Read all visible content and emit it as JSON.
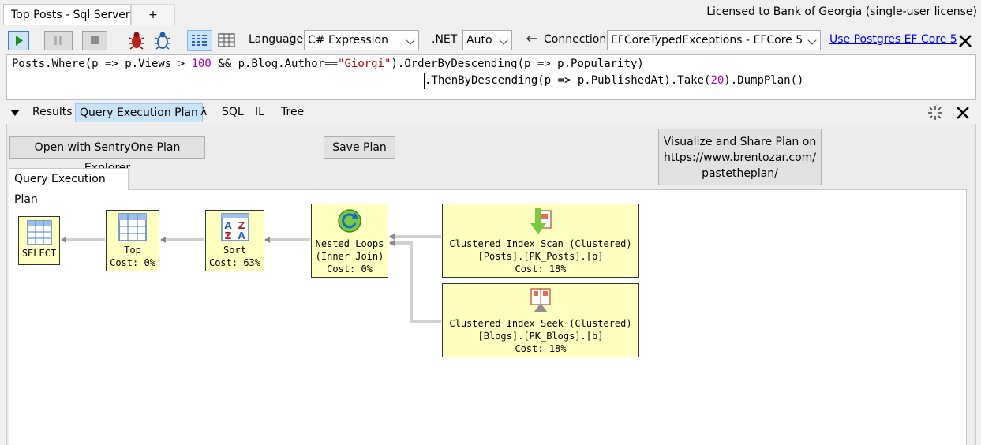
{
  "tabs": [
    {
      "label": "Top Posts - Sql Server"
    },
    {
      "label": "+"
    }
  ],
  "license": "Licensed to Bank of Georgia (single-user license)",
  "toolbar": {
    "language_label": "Language",
    "language_value": "C# Expression",
    "net_label": ".NET",
    "net_value": "Auto",
    "connection_label": "Connection",
    "connection_value": "EFCoreTypedExceptions - EFCore 5",
    "link": "Use Postgres EF Core 5"
  },
  "editor": {
    "line1": {
      "a": "Posts.Where(p => p.Views > ",
      "num1": "100",
      "b": " && p.Blog.Author==",
      "str1": "\"Giorgi\"",
      "c": ").OrderByDescending(p => p.Popularity)"
    },
    "line2": {
      "a": ".ThenByDescending(p => p.PublishedAt).Take(",
      "num1": "20",
      "b": ").DumpPlan()"
    }
  },
  "result_tabs": [
    "Results",
    "Query Execution Plan",
    "λ",
    "SQL",
    "IL",
    "Tree"
  ],
  "panel": {
    "open_button": "Open with SentryOne Plan Explorer",
    "save_button": "Save Plan",
    "visualize_button": {
      "line1": "Visualize and Share Plan on",
      "line2": "https://www.brentozar.com/",
      "line3": "pastetheplan/"
    },
    "plan_tab": "Query Execution Plan"
  },
  "plan_nodes": {
    "select": {
      "label": "SELECT"
    },
    "top": {
      "label": "Top",
      "cost": "Cost: 0%"
    },
    "sort": {
      "label": "Sort",
      "cost": "Cost: 63%"
    },
    "nested": {
      "label1": "Nested Loops",
      "label2": "(Inner Join)",
      "cost": "Cost: 0%"
    },
    "scan": {
      "label1": "Clustered Index Scan (Clustered)",
      "label2": "[Posts].[PK_Posts].[p]",
      "cost": "Cost: 18%"
    },
    "seek": {
      "label1": "Clustered Index Seek (Clustered)",
      "label2": "[Blogs].[PK_Blogs].[b]",
      "cost": "Cost: 18%"
    }
  },
  "colors": {
    "node_fill": "#ffffc0",
    "active_tab": "#c9e3f7",
    "link": "#0000ee",
    "number": "#b000b0",
    "string": "#c00000",
    "run_green": "#1b8f1b"
  },
  "icons": [
    "play-icon",
    "pause-icon",
    "stop-icon",
    "bug-icon",
    "bug-step-icon",
    "rich-text-grid-icon",
    "data-grid-icon",
    "back-arrow-icon",
    "close-icon",
    "collapse-triangle-icon",
    "undock-icon"
  ]
}
